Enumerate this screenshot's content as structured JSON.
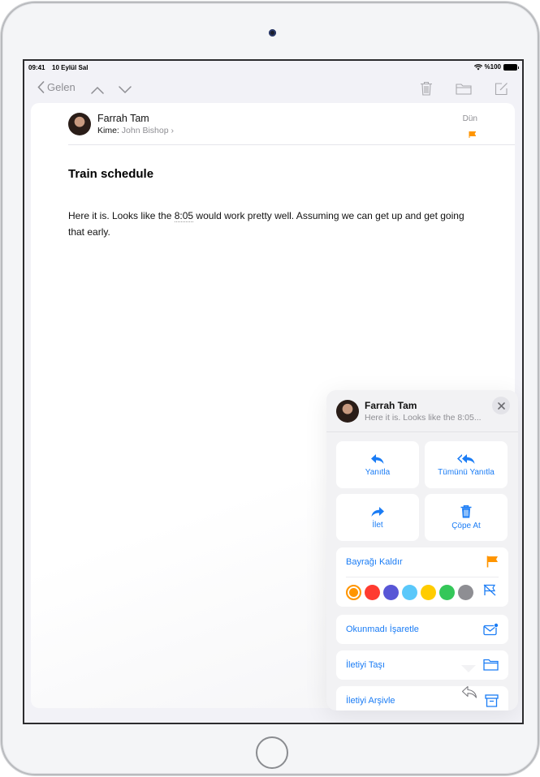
{
  "status_bar": {
    "time": "09:41",
    "date": "10 Eylül Sal",
    "battery": "%100"
  },
  "nav": {
    "back_label": "Gelen",
    "icons": [
      "chevron-left-icon",
      "chevron-up-icon",
      "chevron-down-icon",
      "trash-icon",
      "folder-icon",
      "compose-icon"
    ]
  },
  "message": {
    "sender": "Farrah Tam",
    "to_label": "Kime:",
    "to_name": "John Bishop",
    "date": "Dün",
    "flag_color": "#ff9500",
    "subject": "Train schedule",
    "body_before": "Here it is. Looks like the ",
    "body_link": "8:05",
    "body_after": " would work pretty well. Assuming we can get up and get going that early."
  },
  "menu": {
    "sender": "Farrah Tam",
    "preview": "Here it is. Looks like the 8:05...",
    "actions": [
      {
        "label": "Yanıtla",
        "icon": "reply-icon"
      },
      {
        "label": "Tümünü Yanıtla",
        "icon": "reply-all-icon"
      },
      {
        "label": "İlet",
        "icon": "forward-icon"
      },
      {
        "label": "Çöpe At",
        "icon": "trash-icon"
      }
    ],
    "flag_row": {
      "label": "Bayrağı Kaldır",
      "icon": "flag-icon"
    },
    "flag_colors": [
      {
        "name": "orange",
        "hex": "#ff9500",
        "selected": true
      },
      {
        "name": "red",
        "hex": "#ff3b30",
        "selected": false
      },
      {
        "name": "purple",
        "hex": "#5856d6",
        "selected": false
      },
      {
        "name": "blue",
        "hex": "#5ac8fa",
        "selected": false
      },
      {
        "name": "yellow",
        "hex": "#ffcc00",
        "selected": false
      },
      {
        "name": "green",
        "hex": "#34c759",
        "selected": false
      },
      {
        "name": "gray",
        "hex": "#8e8e93",
        "selected": false
      }
    ],
    "rows": [
      {
        "label": "Okunmadı İşaretle",
        "icon": "mark-unread-icon"
      },
      {
        "label": "İletiyi Taşı",
        "icon": "folder-icon"
      },
      {
        "label": "İletiyi Arşivle",
        "icon": "archive-icon"
      }
    ]
  },
  "colors": {
    "accent": "#1a7cf5",
    "flag": "#ff9500"
  }
}
